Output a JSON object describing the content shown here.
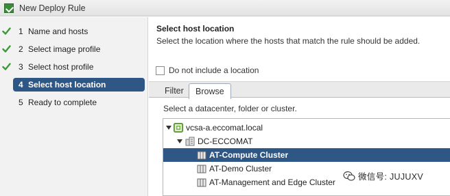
{
  "window": {
    "title": "New Deploy Rule"
  },
  "steps": [
    {
      "num": "1",
      "label": "Name and hosts",
      "done": true
    },
    {
      "num": "2",
      "label": "Select image profile",
      "done": true
    },
    {
      "num": "3",
      "label": "Select host profile",
      "done": true
    },
    {
      "num": "4",
      "label": "Select host location",
      "done": false,
      "active": true
    },
    {
      "num": "5",
      "label": "Ready to complete",
      "done": false
    }
  ],
  "main": {
    "title": "Select host location",
    "description": "Select the location where the hosts that match the rule should be added.",
    "no_location_checkbox": {
      "label": "Do not include a location",
      "checked": false
    },
    "tabs": [
      {
        "label": "Filter"
      },
      {
        "label": "Browse",
        "selected": true
      }
    ],
    "hint": "Select a datacenter, folder or cluster.",
    "tree": [
      {
        "label": "vcsa-a.eccomat.local",
        "icon": "vcenter-icon",
        "expanded": true
      },
      {
        "label": "DC-ECCOMAT",
        "icon": "datacenter-icon",
        "expanded": true
      },
      {
        "label": "AT-Compute Cluster",
        "icon": "cluster-icon",
        "selected": true
      },
      {
        "label": "AT-Demo Cluster",
        "icon": "cluster-icon"
      },
      {
        "label": "AT-Management and Edge Cluster",
        "icon": "cluster-icon"
      }
    ]
  },
  "watermark": {
    "text": "微信号: JUJUXV",
    "icon": "wechat-icon"
  },
  "colors": {
    "accent": "#2f5785",
    "check": "#3a9a35",
    "sidebar_bg": "#f2f2f2"
  }
}
